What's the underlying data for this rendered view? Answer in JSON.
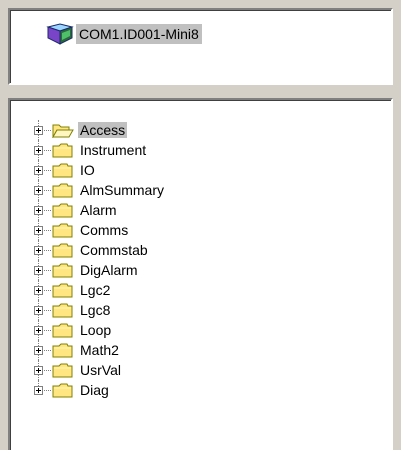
{
  "device": {
    "label": "COM1.ID001-Mini8",
    "icon": "device-cube-icon"
  },
  "tree": {
    "items": [
      {
        "label": "Access",
        "icon": "folder-open-icon",
        "selected": true
      },
      {
        "label": "Instrument",
        "icon": "folder-icon",
        "selected": false
      },
      {
        "label": "IO",
        "icon": "folder-icon",
        "selected": false
      },
      {
        "label": "AlmSummary",
        "icon": "folder-icon",
        "selected": false
      },
      {
        "label": "Alarm",
        "icon": "folder-icon",
        "selected": false
      },
      {
        "label": "Comms",
        "icon": "folder-icon",
        "selected": false
      },
      {
        "label": "Commstab",
        "icon": "folder-icon",
        "selected": false
      },
      {
        "label": "DigAlarm",
        "icon": "folder-icon",
        "selected": false
      },
      {
        "label": "Lgc2",
        "icon": "folder-icon",
        "selected": false
      },
      {
        "label": "Lgc8",
        "icon": "folder-icon",
        "selected": false
      },
      {
        "label": "Loop",
        "icon": "folder-icon",
        "selected": false
      },
      {
        "label": "Math2",
        "icon": "folder-icon",
        "selected": false
      },
      {
        "label": "UsrVal",
        "icon": "folder-icon",
        "selected": false
      },
      {
        "label": "Diag",
        "icon": "folder-icon",
        "selected": false
      }
    ]
  },
  "colors": {
    "panel_bg": "#ffffff",
    "window_bg": "#d4d0c8",
    "selection_bg": "#c0c0c0",
    "folder_fill": "#ffe680",
    "folder_stroke": "#808000"
  }
}
